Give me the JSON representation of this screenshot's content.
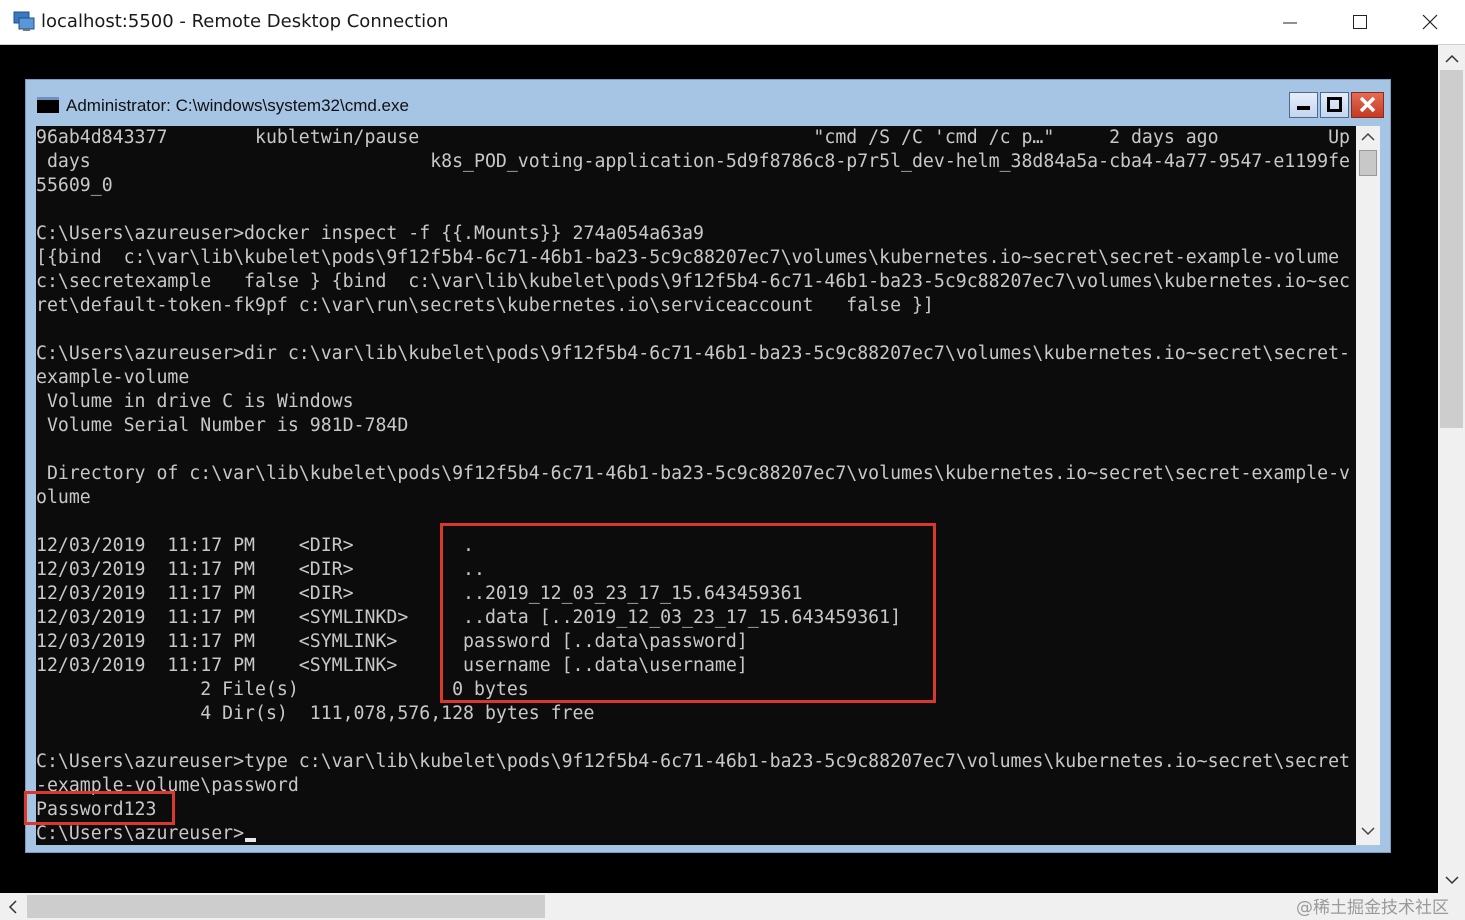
{
  "rdp_window": {
    "title": "localhost:5500 - Remote Desktop Connection",
    "icon": "remote-desktop-icon"
  },
  "cmd_window": {
    "title": "Administrator: C:\\windows\\system32\\cmd.exe",
    "controls": [
      "minimize-icon",
      "maximize-icon",
      "close-icon"
    ]
  },
  "console": {
    "lines": [
      "96ab4d843377        kubletwin/pause                                    \"cmd /S /C 'cmd /c p…\"     2 days ago          Up 2",
      " days                               k8s_POD_voting-application-5d9f8786c8-p7r5l_dev-helm_38d84a5a-cba4-4a77-9547-e1199fe",
      "55609_0",
      "",
      "C:\\Users\\azureuser>docker inspect -f {{.Mounts}} 274a054a63a9",
      "[{bind  c:\\var\\lib\\kubelet\\pods\\9f12f5b4-6c71-46b1-ba23-5c9c88207ec7\\volumes\\kubernetes.io~secret\\secret-example-volume",
      "c:\\secretexample   false } {bind  c:\\var\\lib\\kubelet\\pods\\9f12f5b4-6c71-46b1-ba23-5c9c88207ec7\\volumes\\kubernetes.io~sec",
      "ret\\default-token-fk9pf c:\\var\\run\\secrets\\kubernetes.io\\serviceaccount   false }]",
      "",
      "C:\\Users\\azureuser>dir c:\\var\\lib\\kubelet\\pods\\9f12f5b4-6c71-46b1-ba23-5c9c88207ec7\\volumes\\kubernetes.io~secret\\secret-",
      "example-volume",
      " Volume in drive C is Windows",
      " Volume Serial Number is 981D-784D",
      "",
      " Directory of c:\\var\\lib\\kubelet\\pods\\9f12f5b4-6c71-46b1-ba23-5c9c88207ec7\\volumes\\kubernetes.io~secret\\secret-example-v",
      "olume",
      "",
      "12/03/2019  11:17 PM    <DIR>          .",
      "12/03/2019  11:17 PM    <DIR>          ..",
      "12/03/2019  11:17 PM    <DIR>          ..2019_12_03_23_17_15.643459361",
      "12/03/2019  11:17 PM    <SYMLINKD>     ..data [..2019_12_03_23_17_15.643459361]",
      "12/03/2019  11:17 PM    <SYMLINK>      password [..data\\password]",
      "12/03/2019  11:17 PM    <SYMLINK>      username [..data\\username]",
      "               2 File(s)              0 bytes",
      "               4 Dir(s)  111,078,576,128 bytes free",
      "",
      "C:\\Users\\azureuser>type c:\\var\\lib\\kubelet\\pods\\9f12f5b4-6c71-46b1-ba23-5c9c88207ec7\\volumes\\kubernetes.io~secret\\secret",
      "-example-volume\\password",
      "Password123",
      "C:\\Users\\azureuser>"
    ]
  },
  "watermark": "@稀土掘金技术社区",
  "colors": {
    "highlight": "#d9382c",
    "console_bg": "#0c0c0c",
    "console_fg": "#c8c8c8",
    "cmd_frame": "#a6c4e3"
  }
}
